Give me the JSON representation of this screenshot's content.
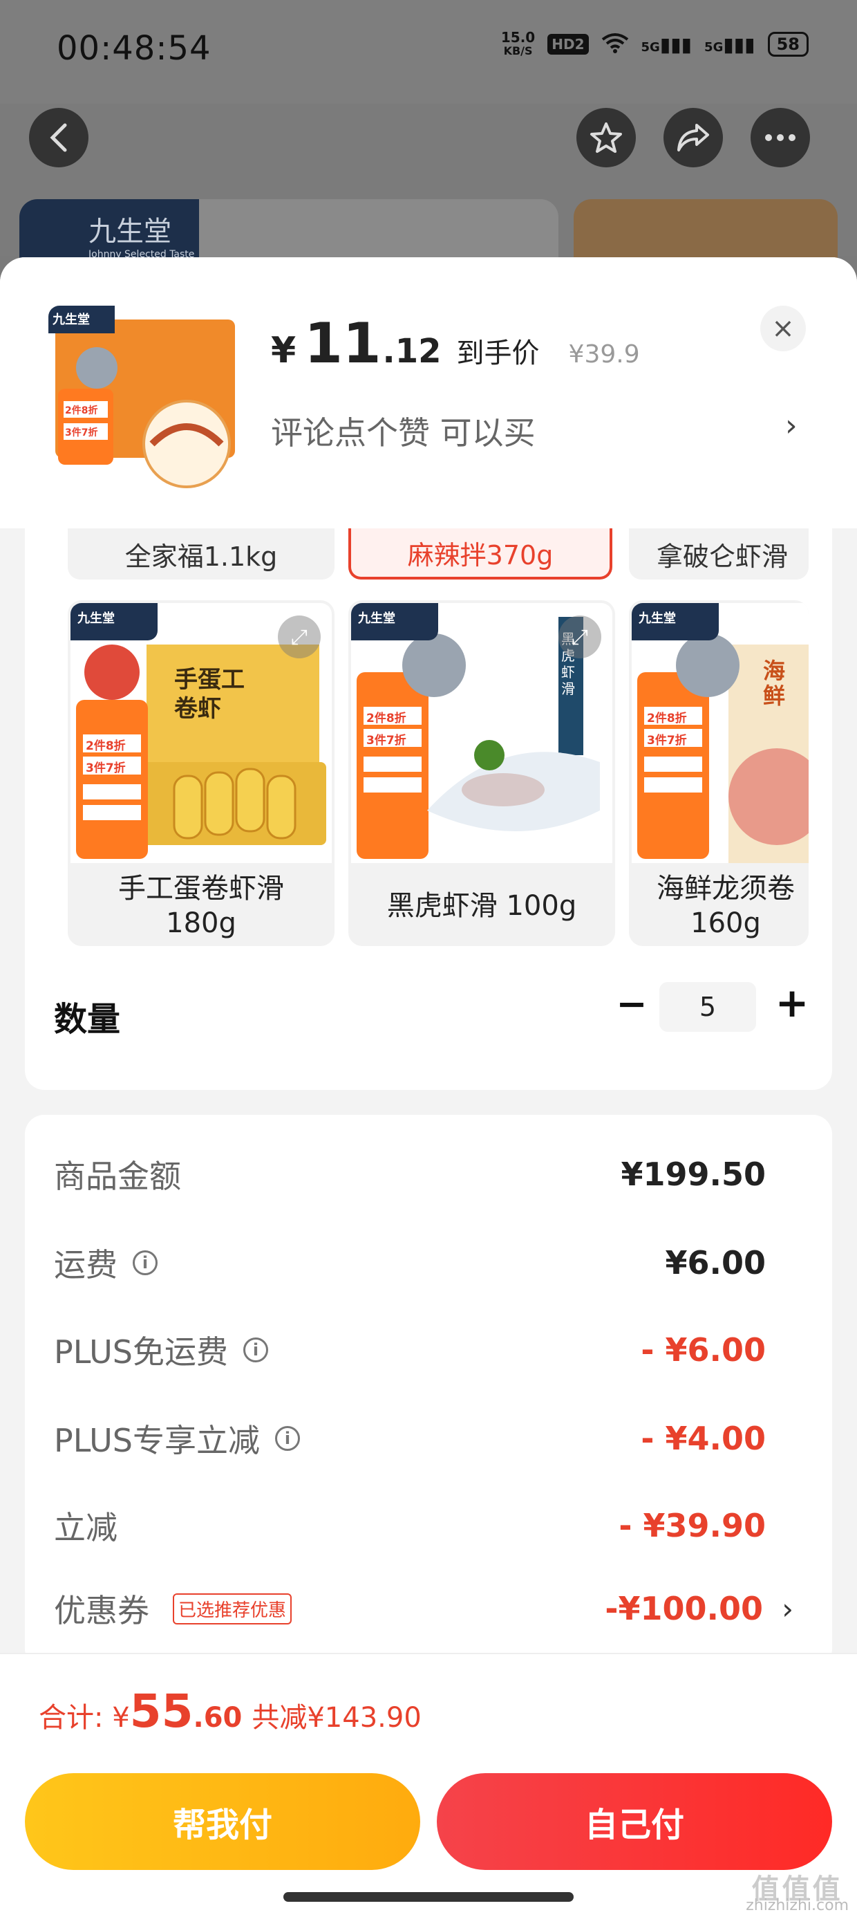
{
  "status_bar": {
    "time": "00:48:54",
    "net_speed_value": "15.0",
    "net_speed_unit": "KB/S",
    "hd": "HD2",
    "signal_1": "5G",
    "signal_2": "5G",
    "battery": "58"
  },
  "background_page": {
    "brand": "九生堂",
    "brand_sub": "Johnny Selected Taste"
  },
  "product": {
    "currency": "¥",
    "price_int": "11",
    "price_dec": ".12",
    "price_tag": "到手价",
    "original_price": "¥39.9",
    "promo_text": "评论点个赞  可以买",
    "close_label": "×"
  },
  "thumbnail": {
    "brand": "九生堂",
    "badge_line1": "2件8折",
    "badge_line2": "3件7折"
  },
  "spec_options_top": [
    {
      "label": "全家福1.1kg"
    },
    {
      "label": "麻辣拌370g"
    },
    {
      "label": "拿破仑虾滑"
    }
  ],
  "spec_cards": [
    {
      "label": "手工蛋卷虾滑\n180g",
      "brand": "九生堂",
      "badge1": "2件8折",
      "badge2": "3件7折",
      "art_text": "手蛋工卷虾"
    },
    {
      "label": "黑虎虾滑 100g",
      "brand": "九生堂",
      "badge1": "2件8折",
      "badge2": "3件7折",
      "art_text": "黑虎虾滑"
    },
    {
      "label": "海鲜龙须卷\n160g",
      "brand": "九生堂",
      "badge1": "2件8折",
      "badge2": "3件7折",
      "art_text": "海鲜"
    }
  ],
  "quantity": {
    "label": "数量",
    "minus": "−",
    "value": "5",
    "plus": "+"
  },
  "summary": {
    "rows": [
      {
        "label": "商品金额",
        "value": "¥199.50"
      },
      {
        "label": "运费",
        "value": "¥6.00"
      },
      {
        "label": "PLUS免运费",
        "value": "- ¥6.00"
      },
      {
        "label": "PLUS专享立减",
        "value": "- ¥4.00"
      },
      {
        "label": "立减",
        "value": "- ¥39.90"
      },
      {
        "label": "优惠券",
        "value": "-¥100.00",
        "badge": "已选推荐优惠",
        "chevron": "›"
      }
    ]
  },
  "total": {
    "label": "合计: ¥",
    "int": "55",
    "dec": ".60",
    "discount": "共减¥143.90"
  },
  "actions": {
    "help_pay": "帮我付",
    "self_pay": "自己付"
  },
  "watermark": {
    "big": "值值值",
    "small": "zhizhizhi.com"
  },
  "colors": {
    "accent_red": "#e8412c",
    "help_button": "#ffb913",
    "self_button": "#f5363a",
    "brand_navy": "#1e3250"
  }
}
